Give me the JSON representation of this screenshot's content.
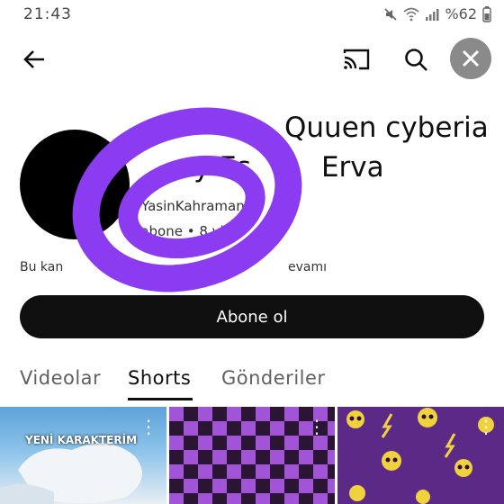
{
  "status_bar": {
    "time": "21:43",
    "battery": "%62",
    "icons": [
      "mute-icon",
      "wifi-icon",
      "signal-icon",
      "battery-icon"
    ]
  },
  "topbar": {
    "icons": [
      "back-arrow-icon",
      "cast-icon",
      "search-icon",
      "close-icon"
    ]
  },
  "channel": {
    "name_line1": "Quuen cyberia",
    "name_line2_start": "ay Es",
    "name_line2_end": "Erva",
    "handle": "@YasinKahraman",
    "stats": "1 abone • 8 vide",
    "description_start": "Bu kan",
    "description_end": "evamı"
  },
  "subscribe_button": {
    "label": "Abone ol"
  },
  "tabs": [
    {
      "label": "Videolar",
      "active": false
    },
    {
      "label": "Shorts",
      "active": true
    },
    {
      "label": "Gönderiler",
      "active": false
    }
  ],
  "shorts": [
    {
      "title": "YENİ KARAKTERİM"
    },
    {
      "title": ""
    },
    {
      "title": ""
    }
  ],
  "colors": {
    "accent_ring": "#8b3cf0",
    "button_bg": "#0f0f0f"
  }
}
